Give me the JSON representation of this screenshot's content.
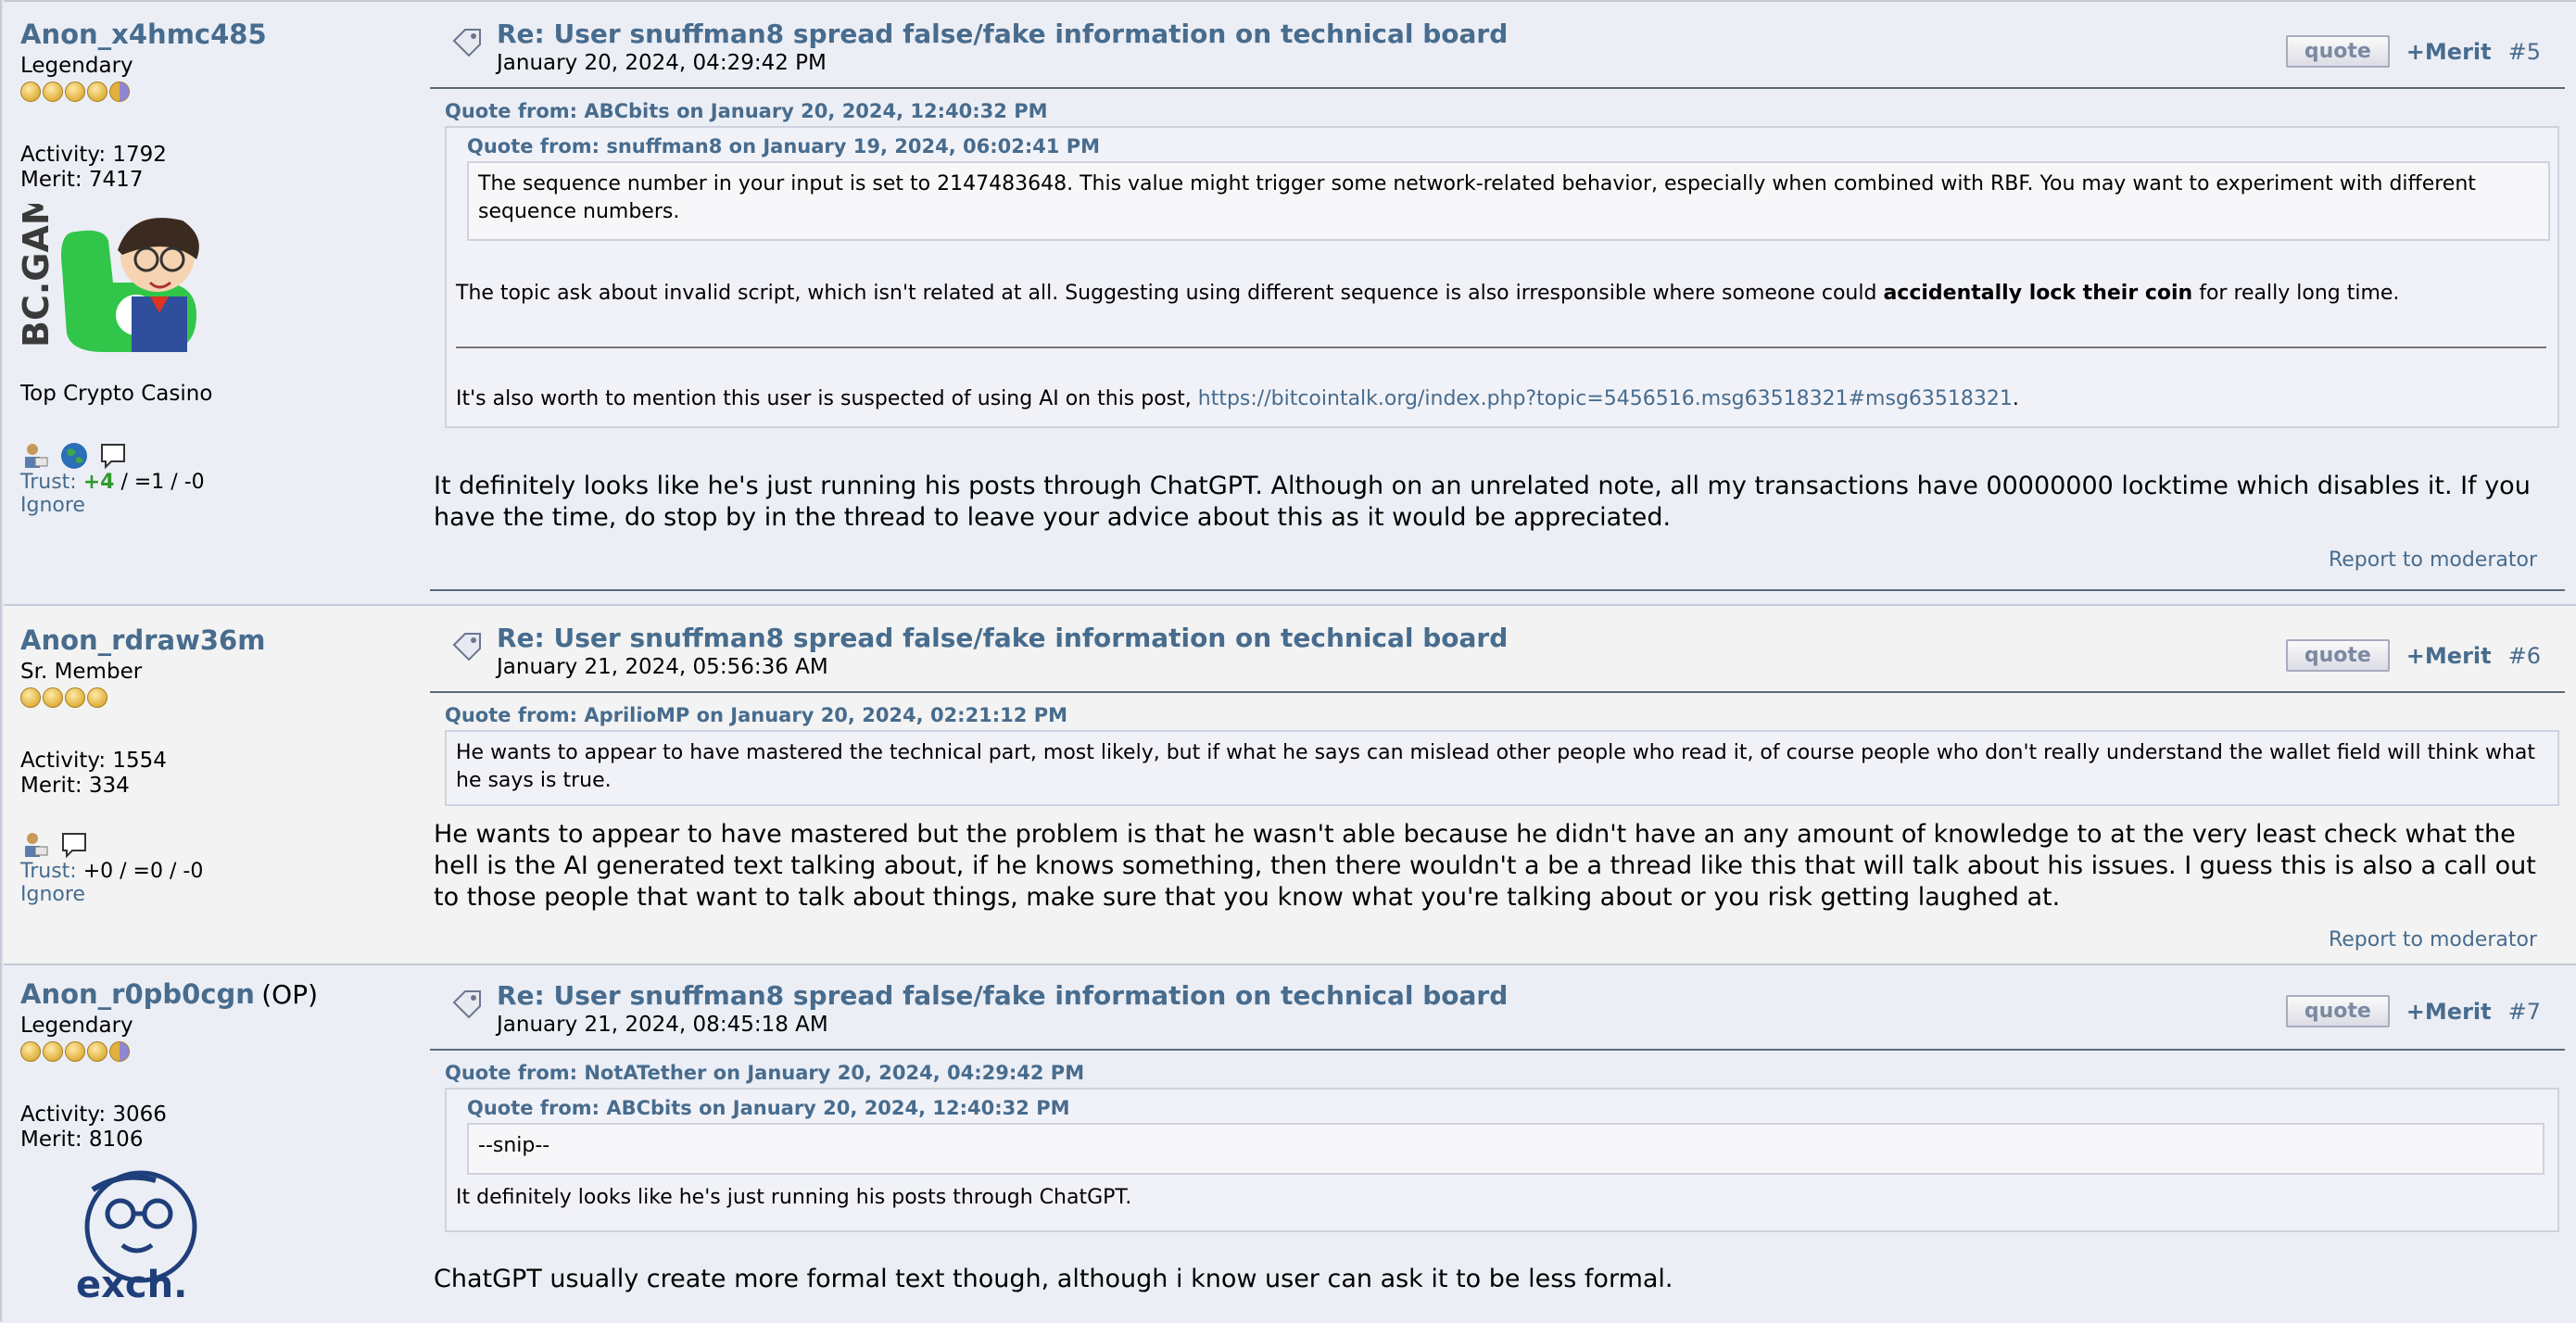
{
  "posts": [
    {
      "user": "Anon_x4hmc485",
      "rank": "Legendary",
      "activity": "Activity: 1792",
      "merit": "Merit: 7417",
      "avatar_text": "BC.GAME",
      "signature": "Top Crypto Casino",
      "trust_label": "Trust:",
      "trust_pos": "+4",
      "trust_rest": "/ =1 / -0",
      "ignore": "Ignore",
      "subject": "Re: User snuffman8 spread false/fake information on technical board",
      "date": "January 20, 2024, 04:29:42 PM",
      "quote_btn": "quote",
      "merit_btn": "+Merit",
      "number": "#5",
      "outer_quote_header": "Quote from: ABCbits on January 20, 2024, 12:40:32 PM",
      "inner_quote_header": "Quote from: snuffman8 on January 19, 2024, 06:02:41 PM",
      "inner_quote_text": "The sequence number in your input is set to 2147483648. This value might trigger some network-related behavior, especially when combined with RBF. You may want to experiment with different sequence numbers.",
      "outer_quote_text_a": "The topic ask about invalid script, which isn't related at all. Suggesting using different sequence is also irresponsible where someone could ",
      "outer_quote_bold": "accidentally lock their coin",
      "outer_quote_text_b": " for really long time.",
      "outer_quote_text_2a": "It's also worth to mention this user is suspected of using AI on this post, ",
      "outer_quote_link": "https://bitcointalk.org/index.php?topic=5456516.msg63518321#msg63518321",
      "outer_quote_text_2b": ".",
      "body": "It definitely looks like he's just running his posts through ChatGPT. Although on an unrelated note, all my transactions have 00000000 locktime which disables it. If you have the time, do stop by in the thread to leave your advice about this as it would be appreciated.",
      "report": "Report to moderator"
    },
    {
      "user": "Anon_rdraw36m",
      "rank": "Sr. Member",
      "activity": "Activity: 1554",
      "merit": "Merit: 334",
      "trust_label": "Trust:",
      "trust_pos": "+0",
      "trust_rest": "/ =0 / -0",
      "ignore": "Ignore",
      "subject": "Re: User snuffman8 spread false/fake information on technical board",
      "date": "January 21, 2024, 05:56:36 AM",
      "quote_btn": "quote",
      "merit_btn": "+Merit",
      "number": "#6",
      "quote_header": "Quote from: AprilioMP on January 20, 2024, 02:21:12 PM",
      "quote_text": "He wants to appear to have mastered the technical part, most likely, but if what he says can mislead other people who read it, of course people who don't really understand the wallet field will think what he says is true.",
      "body": "He wants to appear to have mastered but the problem is that he wasn't able because he didn't have an any amount of knowledge to at the very least check what the hell is the AI generated text talking about, if he knows something, then there wouldn't a be a thread like this that will talk about his issues. I guess this is also a call out to those people that want to talk about things, make sure that you know what you're talking about or you risk getting laughed at.",
      "report": "Report to moderator"
    },
    {
      "user": "Anon_r0pb0cgn",
      "op": "(OP)",
      "rank": "Legendary",
      "activity": "Activity: 3066",
      "merit": "Merit: 8106",
      "avatar_text": "exch.",
      "subject": "Re: User snuffman8 spread false/fake information on technical board",
      "date": "January 21, 2024, 08:45:18 AM",
      "quote_btn": "quote",
      "merit_btn": "+Merit",
      "number": "#7",
      "outer_quote_header": "Quote from: NotATether on January 20, 2024, 04:29:42 PM",
      "inner_quote_header": "Quote from: ABCbits on January 20, 2024, 12:40:32 PM",
      "inner_quote_text": "--snip--",
      "outer_quote_text": "It definitely looks like he's just running his posts through ChatGPT.",
      "body": "ChatGPT usually create more formal text though, although i know user can ask it to be less formal."
    }
  ],
  "colors": {
    "link": "#476c8e",
    "trust_positive": "#2d9a2d",
    "post_bg": "#eceef5",
    "alt_bg": "#f3f3f3"
  }
}
